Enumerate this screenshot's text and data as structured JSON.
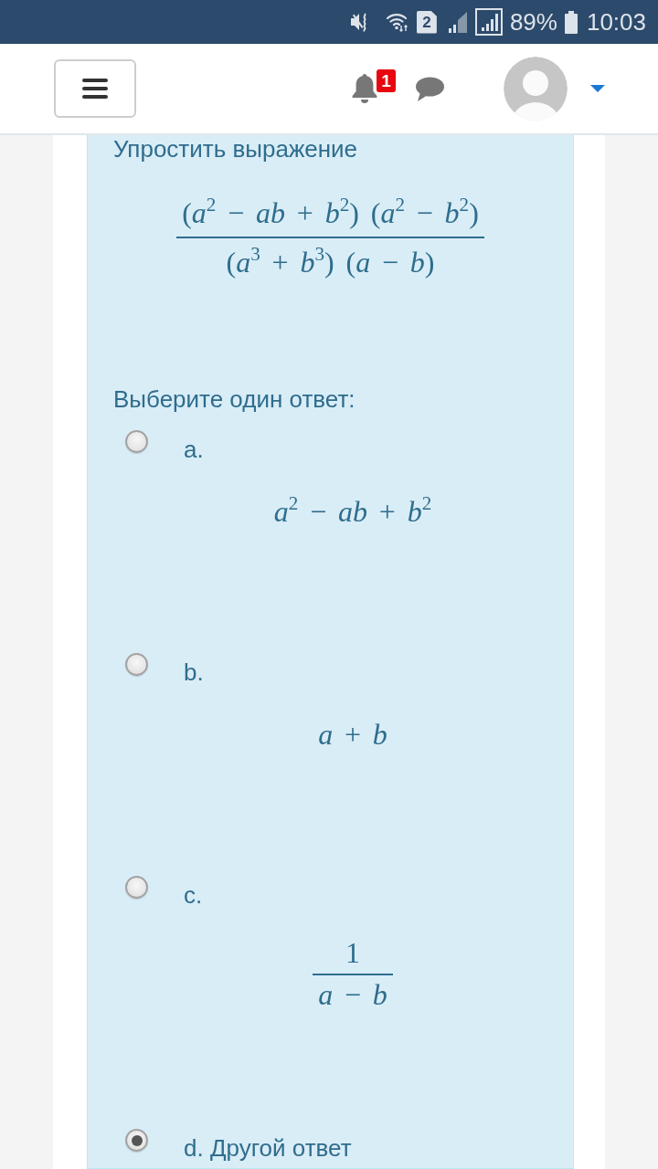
{
  "status_bar": {
    "sim_slot": "2",
    "battery_percent": "89%",
    "time": "10:03"
  },
  "header": {
    "notification_badge": "1"
  },
  "question": {
    "prompt": "Упростить выражение",
    "expression": {
      "kind": "fraction",
      "numerator": "(*a*$^{2}$ − *ab* + *b*$^{2}$) (*a*$^{2}$ − *b*$^{2}$)",
      "denominator": "(*a*$^{3}$ + *b*$^{3}$) (*a* − *b*)"
    },
    "instruction": "Выберите один ответ:",
    "options": [
      {
        "label": "a.",
        "selected": false,
        "answer": {
          "kind": "expression",
          "expression": "*a*$^{2}$ − *ab* + *b*$^{2}$"
        }
      },
      {
        "label": "b.",
        "selected": false,
        "answer": {
          "kind": "expression",
          "expression": "*a* + *b*"
        }
      },
      {
        "label": "c.",
        "selected": false,
        "answer": {
          "kind": "fraction",
          "numerator": "1",
          "denominator": "*a* − *b*"
        }
      },
      {
        "label": "d. Другой ответ",
        "selected": true
      }
    ]
  }
}
